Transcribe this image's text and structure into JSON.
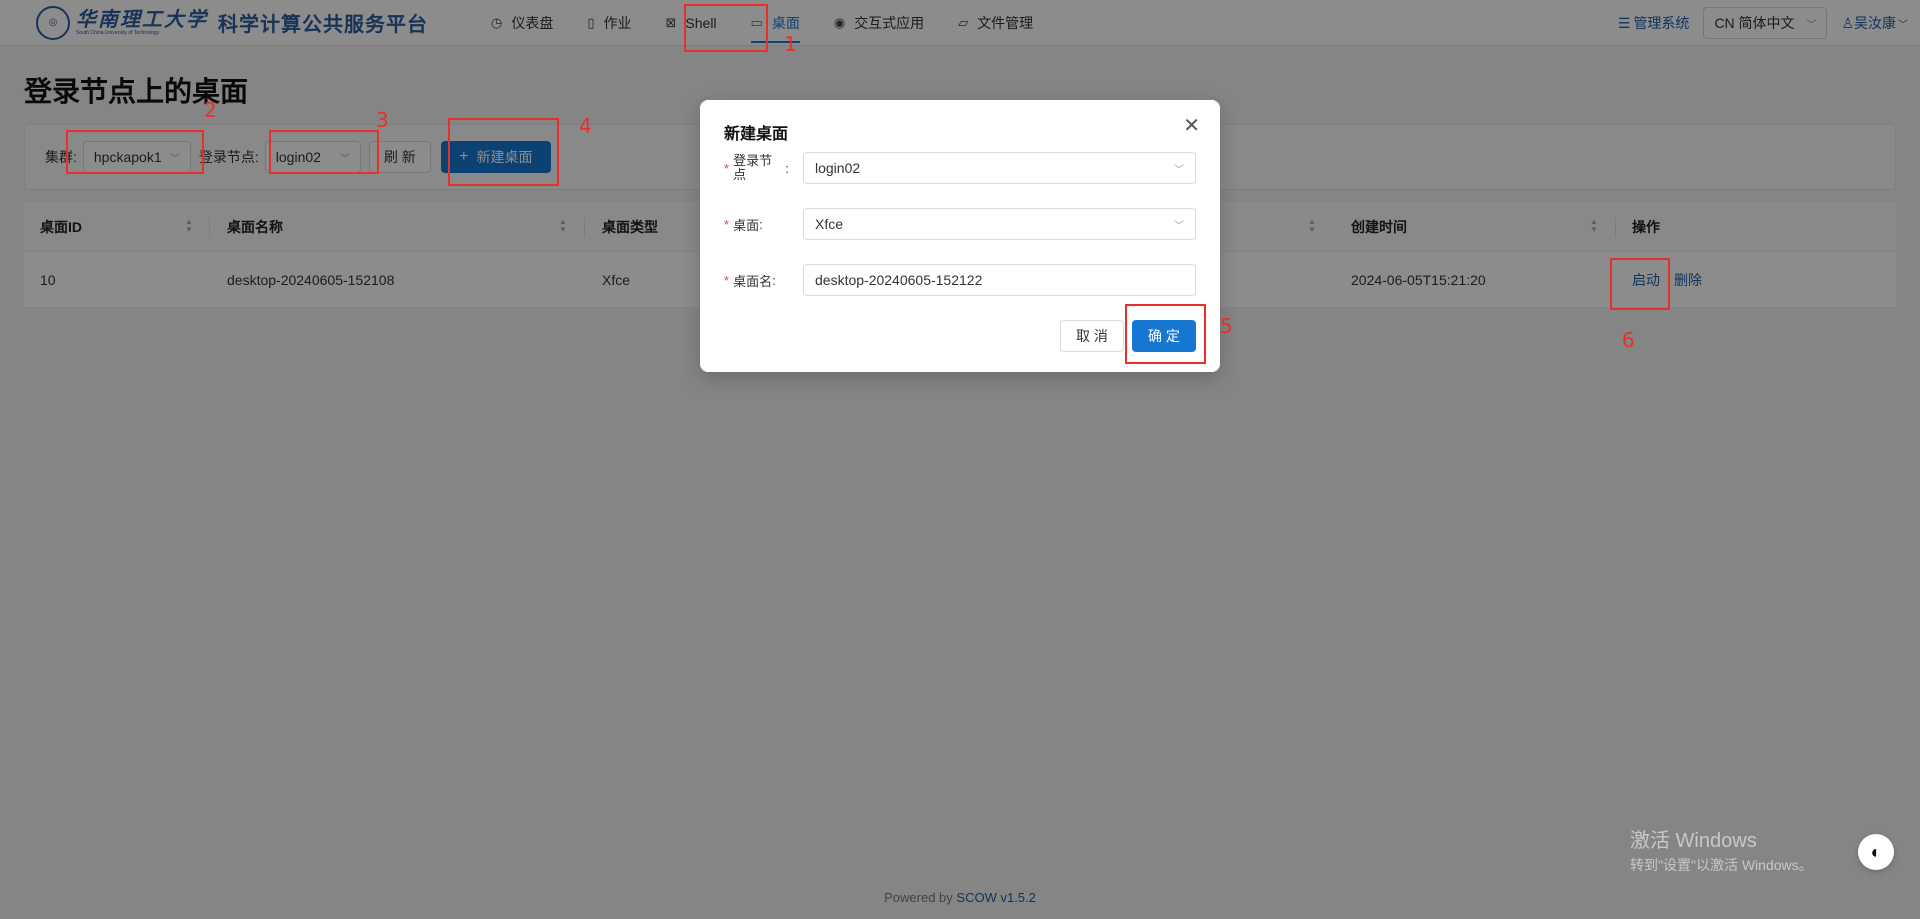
{
  "header": {
    "school_name_cn": "华南理工大学",
    "school_name_en": "South China University of Technology",
    "platform_title": "科学计算公共服务平台",
    "nav": [
      {
        "label": "仪表盘",
        "icon": "dashboard-icon"
      },
      {
        "label": "作业",
        "icon": "file-icon"
      },
      {
        "label": "Shell",
        "icon": "terminal-icon"
      },
      {
        "label": "桌面",
        "icon": "desktop-icon"
      },
      {
        "label": "交互式应用",
        "icon": "eye-icon"
      },
      {
        "label": "文件管理",
        "icon": "folder-icon"
      }
    ],
    "active_nav": "桌面",
    "admin_label": "管理系统",
    "language_label": "CN 简体中文",
    "user_name": "吴汝康"
  },
  "page": {
    "title": "登录节点上的桌面"
  },
  "filters": {
    "cluster_label": "集群:",
    "cluster_value": "hpckapok1",
    "login_node_label": "登录节点:",
    "login_node_value": "login02",
    "refresh_label": "刷 新",
    "new_desktop_label": "新建桌面"
  },
  "table": {
    "columns": [
      "桌面ID",
      "桌面名称",
      "桌面类型",
      "创建时间",
      "操作"
    ],
    "rows": [
      {
        "id": "10",
        "name": "desktop-20240605-152108",
        "type": "Xfce",
        "created": "2024-06-05T15:21:20",
        "action_start": "启动",
        "action_delete": "删除"
      }
    ]
  },
  "modal": {
    "title": "新建桌面",
    "login_node_label": "登录节点",
    "login_node_value": "login02",
    "desktop_label": "桌面",
    "desktop_value": "Xfce",
    "name_label": "桌面名",
    "name_value": "desktop-20240605-152122",
    "cancel_label": "取 消",
    "ok_label": "确 定"
  },
  "annotations": [
    "1",
    "2",
    "3",
    "4",
    "5",
    "6"
  ],
  "footer": {
    "powered_by": "Powered by",
    "version": "SCOW v1.5.2"
  },
  "watermark": {
    "line1": "激活 Windows",
    "line2": "转到\"设置\"以激活 Windows。"
  },
  "colors": {
    "primary": "#1677d3",
    "brand": "#2d5e9e",
    "annotation": "#e8302a"
  }
}
